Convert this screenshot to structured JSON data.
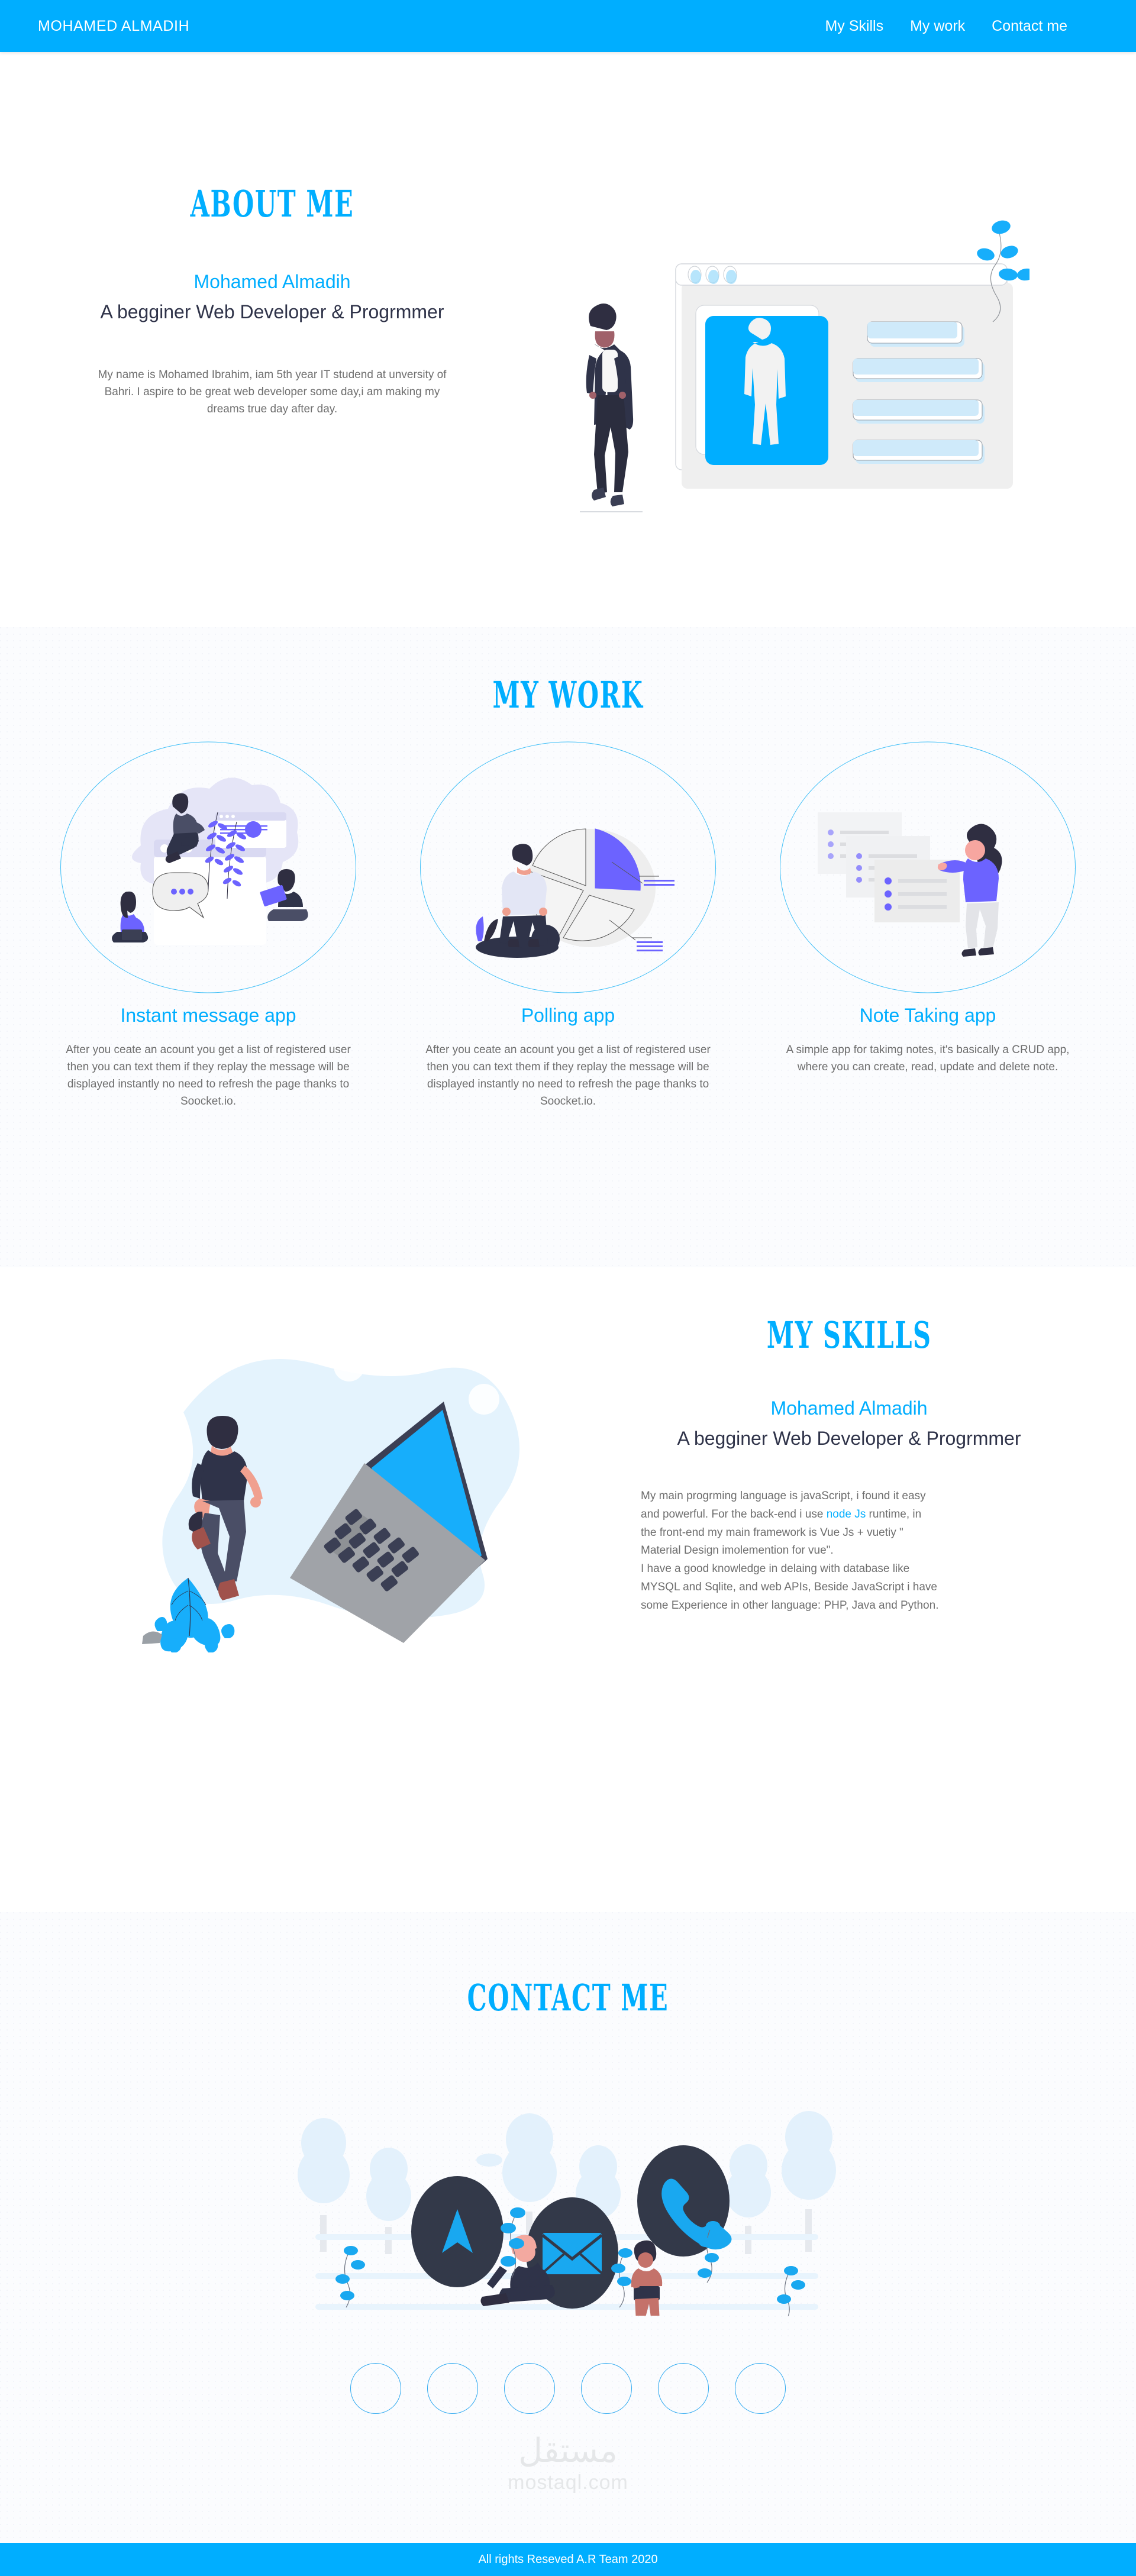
{
  "nav": {
    "brand": "MOHAMED ALMADIH",
    "links": [
      {
        "label": "My Skills"
      },
      {
        "label": "My work"
      },
      {
        "label": "Contact me"
      }
    ]
  },
  "about": {
    "title": "ABOUT ME",
    "name": "Mohamed Almadih",
    "role": "A begginer Web Developer & Progrmmer",
    "paragraph": "My name is Mohamed Ibrahim, iam 5th year IT studend at unversity of Bahri. I aspire to be great web developer some day,i am making my dreams true day after day."
  },
  "work": {
    "title": "MY WORK",
    "cards": [
      {
        "title": "Instant message app",
        "desc": "After you ceate an acount you get a list of registered user then you can text them if they replay the message will be displayed instantly no need to refresh the page thanks to Soocket.io."
      },
      {
        "title": "Polling app",
        "desc": "After you ceate an acount you get a list of registered user then you can text them if they replay the message will be displayed instantly no need to refresh the page thanks to Soocket.io."
      },
      {
        "title": "Note Taking app",
        "desc": "A simple app for takimg notes, it's basically a CRUD app, where you can create, read, update and delete note."
      }
    ]
  },
  "skills": {
    "title": "MY SKILLS",
    "name": "Mohamed Almadih",
    "role": "A begginer Web Developer & Progrmmer",
    "para_line1": "My main progrming language is javaScript, i found it easy",
    "para_line2a": " and powerful. For the back-end i use ",
    "para_highlight": "node Js",
    "para_line2b": " runtime, in",
    "para_line3": "the front-end my main framework is Vue Js + vuetiy \"",
    "para_line4": "Material Design imolemention for vue\".",
    "para_line5": "I have a good knowledge in delaing with database like",
    "para_line6": "MYSQL and Sqlite, and web APIs, Beside JavaScript i have",
    "para_line7": " some Experience in other language: PHP, Java and Python."
  },
  "contact": {
    "title": "CONTACT ME",
    "icons": [
      {
        "name": "navigation-icon"
      },
      {
        "name": "envelope-icon"
      },
      {
        "name": "phone-icon"
      }
    ],
    "social_count": 6
  },
  "watermark": {
    "arabic": "مستقل",
    "latin": "mostaql.com"
  },
  "footer": {
    "text": "All rights Reseved A.R Team 2020"
  },
  "colors": {
    "accent": "#00AEFF",
    "dark": "#2f3349",
    "body_text": "#6e6e6e",
    "purple": "#6c63ff",
    "section_bg": "#fbfcfe"
  }
}
